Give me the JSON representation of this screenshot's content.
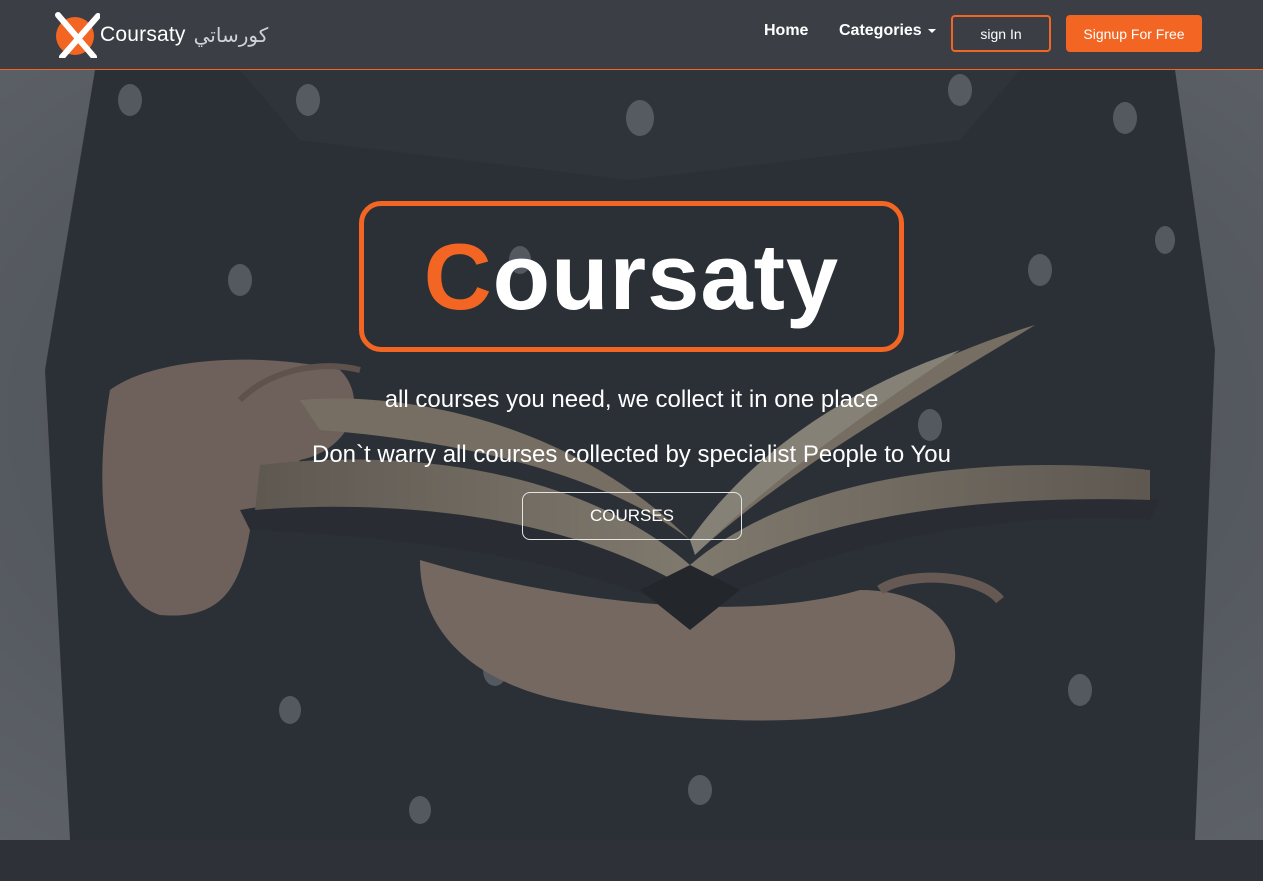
{
  "nav": {
    "brand_name": "Coursaty",
    "brand_arabic": "كورساتي",
    "home_label": "Home",
    "categories_label": "Categories",
    "signin_label": "sign In",
    "signup_label": "Signup For Free"
  },
  "hero": {
    "logo_first_letter": "C",
    "logo_rest": "oursaty",
    "tagline_1": "all courses you need, we collect it in one place",
    "tagline_2": "Don`t warry all courses collected by specialist People to You",
    "courses_button": "COURSES"
  },
  "colors": {
    "accent": "#f26522",
    "navbar_bg": "#3b3f45",
    "text": "#ffffff"
  },
  "icons": {
    "brand_logo": "orange-circle-x-logo-icon",
    "categories_caret": "caret-down-icon"
  }
}
